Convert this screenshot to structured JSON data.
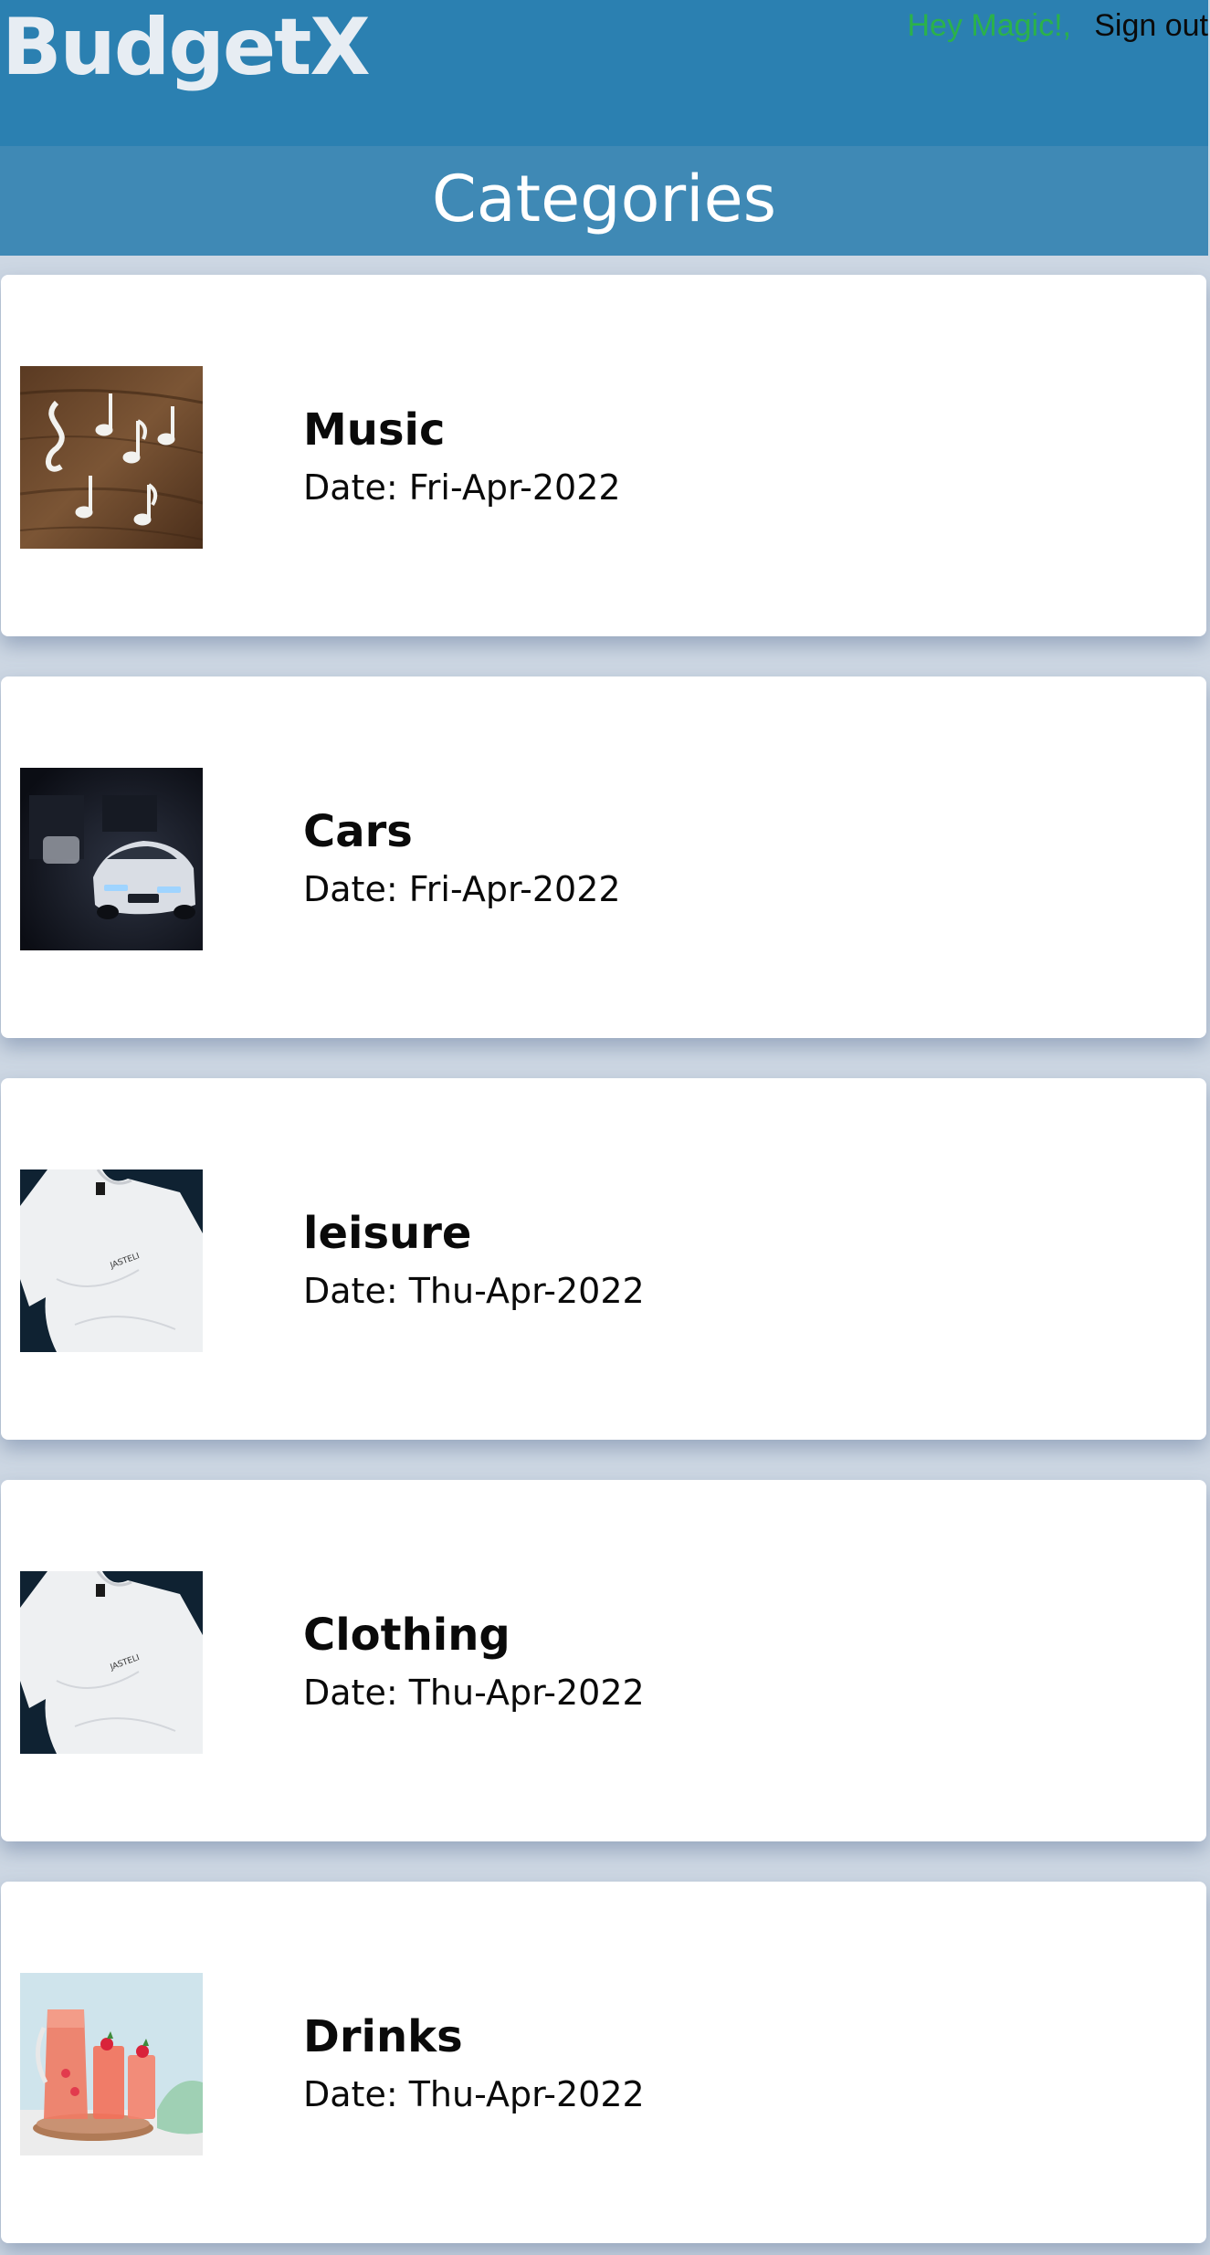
{
  "header": {
    "brand": "BudgetX",
    "greeting": "Hey Magic!,",
    "signout_label": "Sign out"
  },
  "page": {
    "title": "Categories"
  },
  "categories": [
    {
      "name": "Music",
      "date": "Date: Fri-Apr-2022",
      "image_icon": "music-notes-image"
    },
    {
      "name": "Cars",
      "date": "Date: Fri-Apr-2022",
      "image_icon": "car-image"
    },
    {
      "name": "leisure",
      "date": "Date: Thu-Apr-2022",
      "image_icon": "tshirt-image"
    },
    {
      "name": "Clothing",
      "date": "Date: Thu-Apr-2022",
      "image_icon": "tshirt-image"
    },
    {
      "name": "Drinks",
      "date": "Date: Thu-Apr-2022",
      "image_icon": "drinks-image"
    }
  ],
  "colors": {
    "topbar": "#2b80b1",
    "page_header": "#3f89b5",
    "background": "#cdd7e3",
    "greeting": "#2bb24a"
  }
}
